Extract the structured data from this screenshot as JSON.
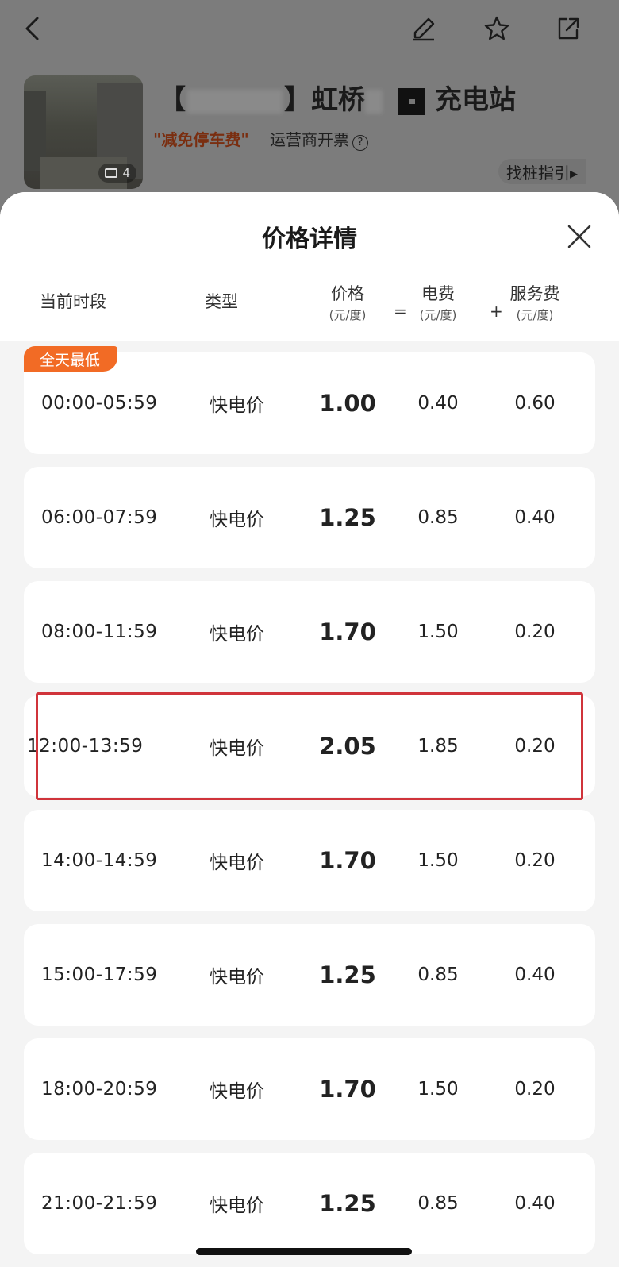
{
  "station": {
    "title_prefix": "【",
    "title_mid": "】虹桥",
    "title_suffix": "充电站",
    "promo": "\"减免停车费\"",
    "invoice": "运营商开票",
    "invoice_help": "?",
    "guide": "找桩指引▸",
    "photo_count": "4"
  },
  "sheet": {
    "title": "价格详情",
    "columns": {
      "time": "当前时段",
      "type": "类型",
      "price": "价格",
      "price_unit": "(元/度)",
      "equals": "=",
      "electric": "电费",
      "electric_unit": "(元/度)",
      "plus": "+",
      "service": "服务费",
      "service_unit": "(元/度)"
    },
    "lowest_tag": "全天最低",
    "rows": [
      {
        "time": "00:00-05:59",
        "type": "快电价",
        "price": "1.00",
        "electric": "0.40",
        "service": "0.60"
      },
      {
        "time": "06:00-07:59",
        "type": "快电价",
        "price": "1.25",
        "electric": "0.85",
        "service": "0.40"
      },
      {
        "time": "08:00-11:59",
        "type": "快电价",
        "price": "1.70",
        "electric": "1.50",
        "service": "0.20"
      },
      {
        "time": "12:00-13:59",
        "type": "快电价",
        "price": "2.05",
        "electric": "1.85",
        "service": "0.20"
      },
      {
        "time": "14:00-14:59",
        "type": "快电价",
        "price": "1.70",
        "electric": "1.50",
        "service": "0.20"
      },
      {
        "time": "15:00-17:59",
        "type": "快电价",
        "price": "1.25",
        "electric": "0.85",
        "service": "0.40"
      },
      {
        "time": "18:00-20:59",
        "type": "快电价",
        "price": "1.70",
        "electric": "1.50",
        "service": "0.20"
      },
      {
        "time": "21:00-21:59",
        "type": "快电价",
        "price": "1.25",
        "electric": "0.85",
        "service": "0.40"
      }
    ]
  },
  "colors": {
    "accent_orange": "#f26b25",
    "highlight_red": "#d0343b"
  },
  "icons": [
    "back-icon",
    "edit-icon",
    "star-icon",
    "share-icon",
    "close-icon",
    "image-icon"
  ]
}
